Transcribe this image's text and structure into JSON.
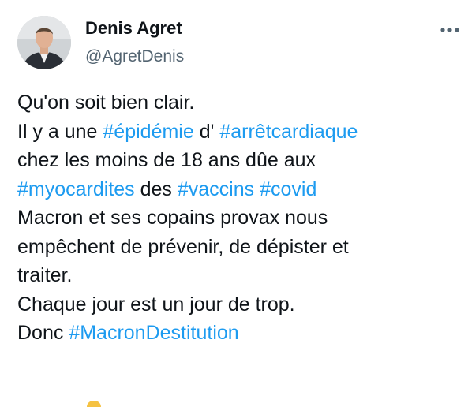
{
  "author": {
    "name": "Denis Agret",
    "handle": "@AgretDenis",
    "avatar_icon": "profile-photo-icon"
  },
  "menu": {
    "icon": "more-options-icon"
  },
  "content": {
    "l1": "Qu'on soit bien clair.",
    "l2_a": "Il y a une ",
    "l2_tag1": "#épidémie",
    "l2_b": " d' ",
    "l2_tag2": "#arrêtcardiaque",
    "l3": "chez les moins de 18 ans dûe aux",
    "l4_tag1": "#myocardites",
    "l4_a": " des ",
    "l4_tag2": "#vaccins",
    "l4_b": " ",
    "l4_tag3": "#covid",
    "l5": "Macron et ses copains provax nous",
    "l6": "empêchent de prévenir, de dépister et",
    "l7": "traiter.",
    "l8": "Chaque jour est un jour de trop.",
    "l9_a": "Donc ",
    "l9_tag": "#MacronDestitution"
  },
  "colors": {
    "hashtag": "#1d9bf0",
    "text": "#0f1419",
    "secondary": "#536471"
  }
}
